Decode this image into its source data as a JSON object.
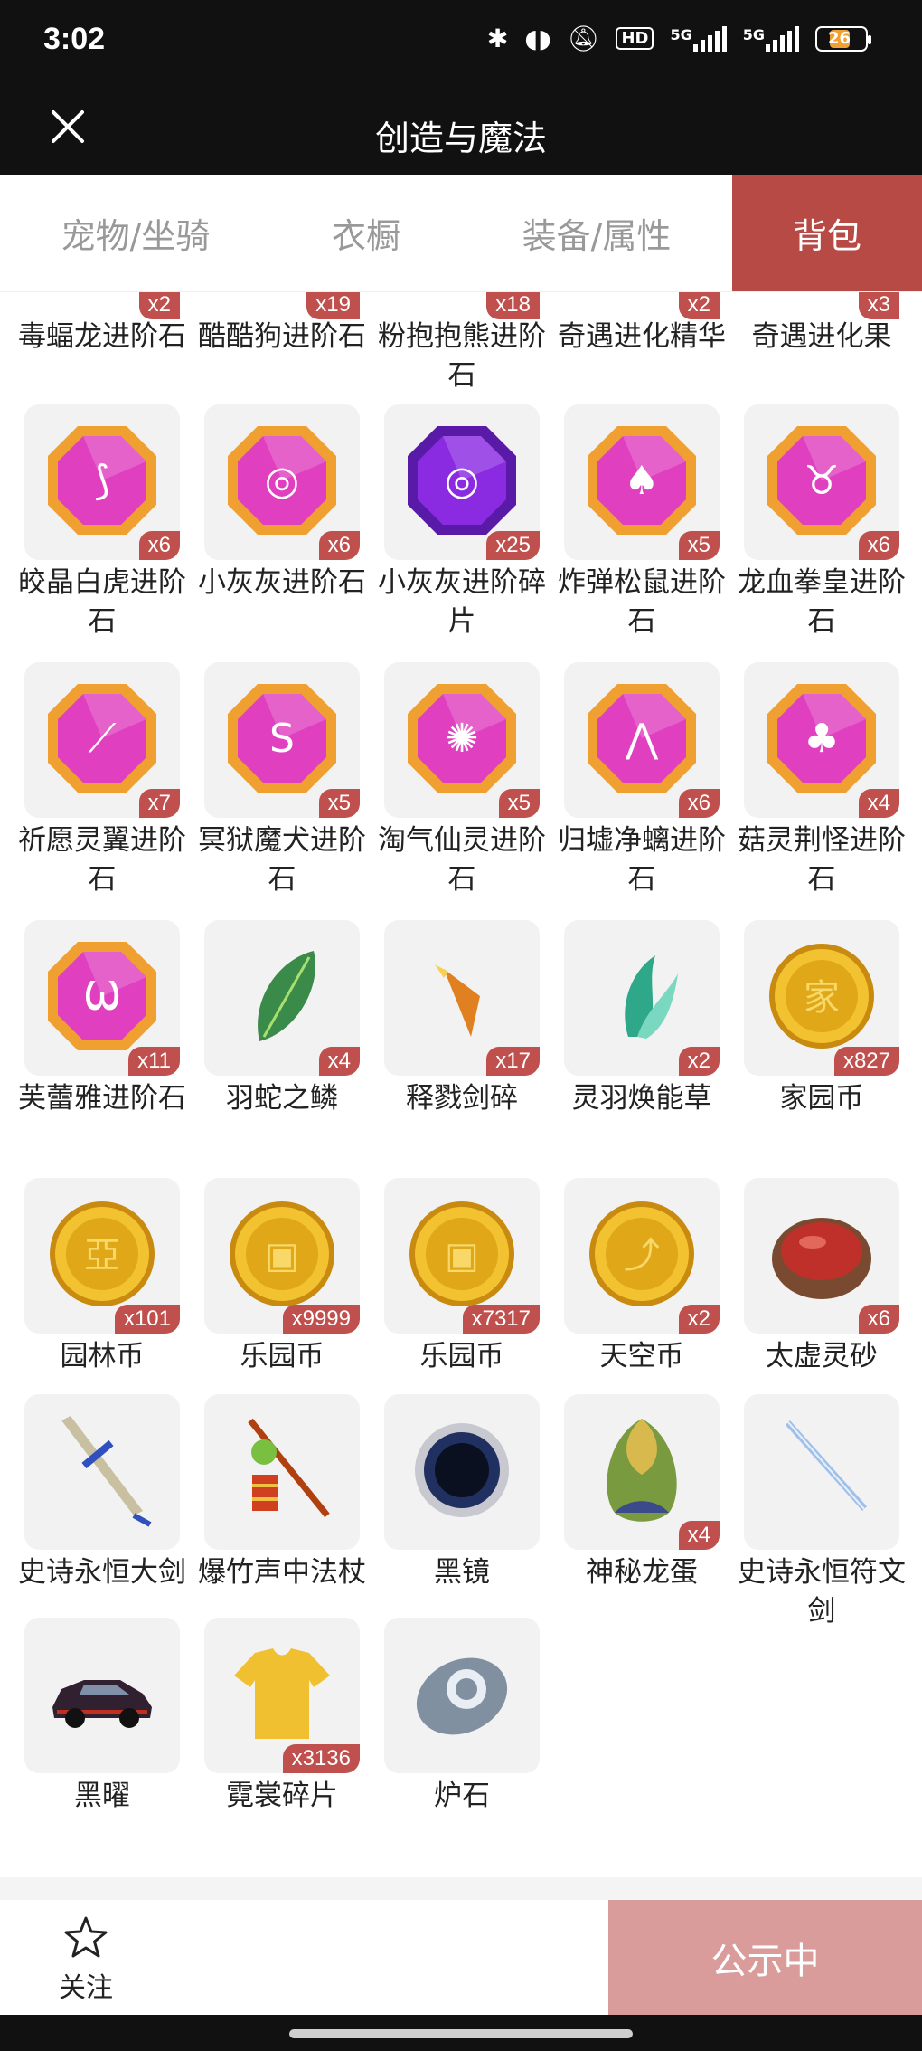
{
  "status": {
    "time": "3:02",
    "battery": "26",
    "network1": "5G",
    "network2": "5G",
    "hd": "HD"
  },
  "header": {
    "title": "创造与魔法"
  },
  "tabs": [
    {
      "label": "宠物/坐骑",
      "active": false
    },
    {
      "label": "衣橱",
      "active": false
    },
    {
      "label": "装备/属性",
      "active": false
    },
    {
      "label": "背包",
      "active": true
    }
  ],
  "partial_row": [
    {
      "name": "毒蝠龙进阶石",
      "count": "x2"
    },
    {
      "name": "酷酷狗进阶石",
      "count": "x19"
    },
    {
      "name": "粉抱抱熊进阶石",
      "count": "x18"
    },
    {
      "name": "奇遇进化精华",
      "count": "x2"
    },
    {
      "name": "奇遇进化果",
      "count": "x3"
    }
  ],
  "items": [
    {
      "name": "皎晶白虎进阶石",
      "count": "x6",
      "icon": "fang-gem-icon",
      "color": "#e040c0"
    },
    {
      "name": "小灰灰进阶石",
      "count": "x6",
      "icon": "lollipop-gem-icon",
      "color": "#e040c0"
    },
    {
      "name": "小灰灰进阶碎片",
      "count": "x25",
      "icon": "lollipop-gem-icon",
      "color": "#8a2be2"
    },
    {
      "name": "炸弹松鼠进阶石",
      "count": "x5",
      "icon": "acorn-gem-icon",
      "color": "#e040c0"
    },
    {
      "name": "龙血拳皇进阶石",
      "count": "x6",
      "icon": "bull-gem-icon",
      "color": "#e040c0"
    },
    {
      "name": "祈愿灵翼进阶石",
      "count": "x7",
      "icon": "wing-gem-icon",
      "color": "#e040c0"
    },
    {
      "name": "冥狱魔犬进阶石",
      "count": "x5",
      "icon": "serpent-gem-icon",
      "color": "#e040c0"
    },
    {
      "name": "淘气仙灵进阶石",
      "count": "x5",
      "icon": "triskele-gem-icon",
      "color": "#e040c0"
    },
    {
      "name": "归墟净螭进阶石",
      "count": "x6",
      "icon": "dragon-gem-icon",
      "color": "#e040c0"
    },
    {
      "name": "菇灵荆怪进阶石",
      "count": "x4",
      "icon": "mushroom-gem-icon",
      "color": "#e040c0"
    },
    {
      "name": "芙蕾雅进阶石",
      "count": "x11",
      "icon": "horns-gem-icon",
      "color": "#e040c0"
    },
    {
      "name": "羽蛇之鳞",
      "count": "x4",
      "icon": "green-scale-icon",
      "color": "#3a8a4a"
    },
    {
      "name": "释戮剑碎",
      "count": "x17",
      "icon": "sword-shard-icon",
      "color": "#e08020"
    },
    {
      "name": "灵羽焕能草",
      "count": "x2",
      "icon": "feather-grass-icon",
      "color": "#2fa88a"
    },
    {
      "name": "家园币",
      "count": "x827",
      "icon": "home-coin-icon",
      "color": "#e8b020"
    },
    {
      "name": "园林币",
      "count": "x101",
      "icon": "garden-coin-icon",
      "color": "#e8b020"
    },
    {
      "name": "乐园币",
      "count": "x9999",
      "icon": "chest-coin-icon",
      "color": "#e8b020"
    },
    {
      "name": "乐园币",
      "count": "x7317",
      "icon": "chest-coin-icon",
      "color": "#e8b020"
    },
    {
      "name": "天空币",
      "count": "x2",
      "icon": "bow-coin-icon",
      "color": "#e8b020"
    },
    {
      "name": "太虚灵砂",
      "count": "x6",
      "icon": "red-orb-icon",
      "color": "#c0302a"
    },
    {
      "name": "史诗永恒大剑",
      "count": "",
      "icon": "greatsword-icon",
      "color": "#3050c0"
    },
    {
      "name": "爆竹声中法杖",
      "count": "",
      "icon": "firecracker-staff-icon",
      "color": "#d04020"
    },
    {
      "name": "黑镜",
      "count": "",
      "icon": "black-mirror-icon",
      "color": "#203060"
    },
    {
      "name": "神秘龙蛋",
      "count": "x4",
      "icon": "dragon-egg-icon",
      "color": "#7a9a40"
    },
    {
      "name": "史诗永恒符文剑",
      "count": "",
      "icon": "rune-sword-icon",
      "color": "#a0c0e8"
    },
    {
      "name": "黑曜",
      "count": "",
      "icon": "black-car-icon",
      "color": "#302030"
    },
    {
      "name": "霓裳碎片",
      "count": "x3136",
      "icon": "yellow-shirt-icon",
      "color": "#f0c030"
    },
    {
      "name": "炉石",
      "count": "",
      "icon": "hearthstone-icon",
      "color": "#8090a0"
    }
  ],
  "bottom": {
    "follow_label": "关注",
    "publish_label": "公示中"
  }
}
